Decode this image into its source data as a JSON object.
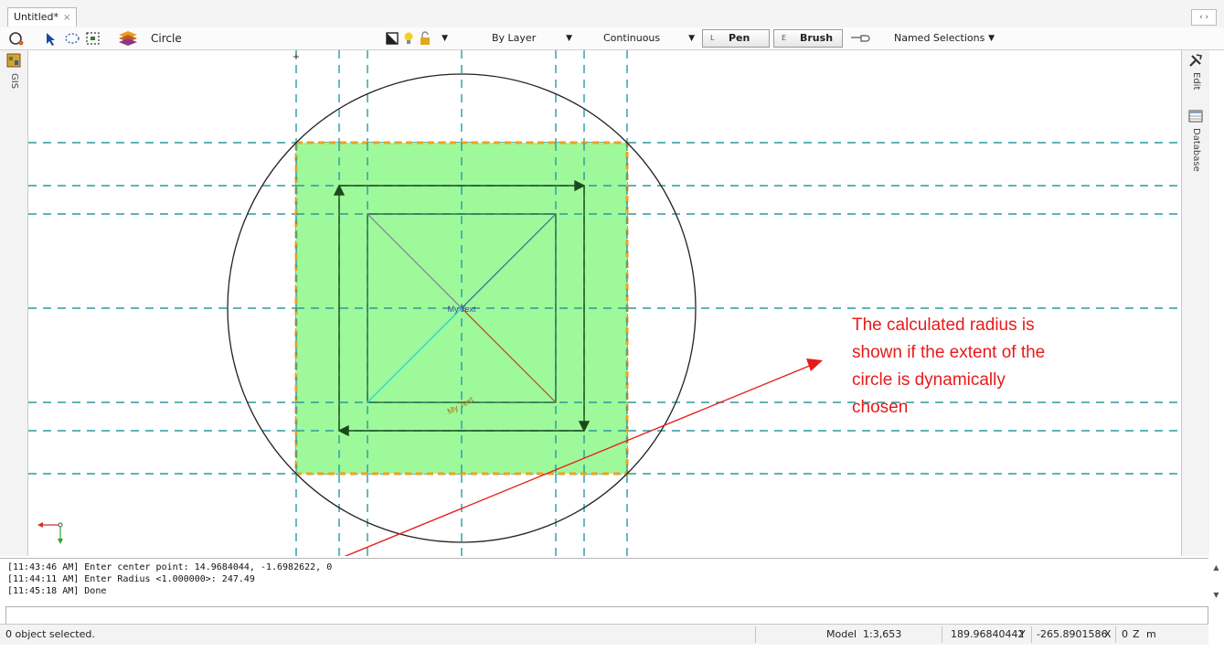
{
  "tabs": [
    {
      "label": "Untitled*",
      "close": "×"
    }
  ],
  "tab_scroll": "‹ ›",
  "toolbar": {
    "mode_label": "Circle",
    "linetype_color": "By Layer",
    "linestyle": "Continuous",
    "pen": {
      "key": "L",
      "label": "Pen"
    },
    "brush": {
      "key": "E",
      "label": "Brush"
    },
    "named_selections": "Named Selections"
  },
  "left_panel": {
    "label": "GIS"
  },
  "right_panel": {
    "edit_label": "Edit",
    "database_label": "Database"
  },
  "canvas": {
    "text_top": "My Text",
    "text_bottom": "My Text",
    "annotation": [
      "The calculated radius is",
      "shown if the extent of the",
      "circle is dynamically",
      "chosen"
    ],
    "colors": {
      "fill": "#9ef99a",
      "guide": "#2a9aa0",
      "border": "#f0a020",
      "annotation": "#e81a1a"
    }
  },
  "log": [
    "[11:43:46 AM] Enter center point: 14.9684044, -1.6982622, 0",
    "[11:44:11 AM] Enter Radius <1.000000>: 247.49",
    "[11:45:18 AM] Done"
  ],
  "status": {
    "selection": "0 object selected.",
    "space": "Model",
    "scale": "1:3,653",
    "coord_y_value": "189.96840442",
    "coord_y_label": "Y",
    "coord_x_value": "-265.8901586",
    "coord_x_label": "X",
    "coord_z_value": "0",
    "coord_z_label": "Z",
    "unit": "m"
  }
}
